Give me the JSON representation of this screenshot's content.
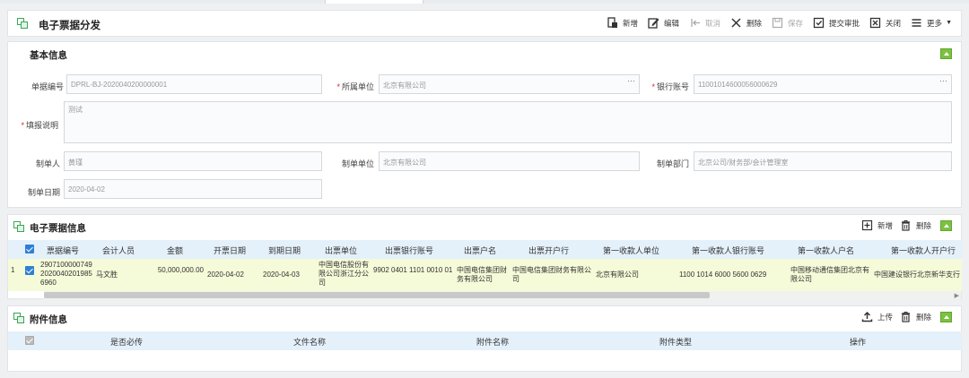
{
  "title": "电子票据分发",
  "toolbar": [
    {
      "label": "新增",
      "icon": "add-doc-icon",
      "disabled": false
    },
    {
      "label": "编辑",
      "icon": "edit-icon",
      "disabled": false
    },
    {
      "label": "取消",
      "icon": "cancel-icon",
      "disabled": true
    },
    {
      "label": "删除",
      "icon": "close-icon",
      "disabled": false
    },
    {
      "label": "保存",
      "icon": "save-icon",
      "disabled": true
    },
    {
      "label": "提交审批",
      "icon": "checkbox-icon",
      "disabled": false
    },
    {
      "label": "关闭",
      "icon": "close-box-icon",
      "disabled": false
    },
    {
      "label": "更多",
      "icon": "menu-icon",
      "disabled": false
    }
  ],
  "basic": {
    "title": "基本信息",
    "bill_no_label": "单据编号",
    "bill_no": "DPRL-BJ-2020040200000001",
    "unit_label": "所属单位",
    "unit": "北京有限公司",
    "account_label": "银行账号",
    "account": "1100101460005600062​9",
    "remark_label": "填报说明",
    "remark": "测试",
    "maker_label": "制单人",
    "maker": "黄瑾",
    "maker_unit_label": "制单单位",
    "maker_unit": "北京有限公司",
    "maker_dept_label": "制单部门",
    "maker_dept": "北京公司/财务部/会计管理室",
    "date_label": "制单日期",
    "date": "2020-04-02",
    "more_glyph": "···"
  },
  "ticket": {
    "title": "电子票据信息",
    "add_label": "新增",
    "delete_label": "删除",
    "headers": [
      "票据编号",
      "会计人员",
      "金额",
      "开票日期",
      "到期日期",
      "出票单位",
      "出票银行账号",
      "出票户名",
      "出票开户行",
      "第一收款人单位",
      "第一收款人银行账号",
      "第一收款人户名",
      "第一收款人开户行"
    ],
    "row": {
      "index": "1",
      "bill_no": "290710000074920200402019856960",
      "accountant": "马文胜",
      "amount": "50,000,000.00",
      "issue_date": "2020-04-02",
      "due_date": "2020-04-03",
      "drawer": "中国电信股份有限公司浙江分公司",
      "drawer_account": "9902 0401 1101 0010 01",
      "drawer_name": "中国电信集团财务有限公司",
      "drawer_bank": "中国电信集团财务有限公司",
      "payee_unit": "北京有限公司",
      "payee_account": "1100 1014 6000 5600 0629",
      "payee_name": "中国移动通信集团北京有限公司",
      "payee_bank": "中国建设银行北京新华支行"
    }
  },
  "attach": {
    "title": "附件信息",
    "upload_label": "上传",
    "delete_label": "删除",
    "headers": [
      "是否必传",
      "文件名称",
      "附件名称",
      "附件类型",
      "操作"
    ]
  },
  "colors": {
    "accent_green": "#7cc142",
    "header_blue": "#e4f1fb",
    "row_highlight": "#f5fbd8",
    "required_red": "#e02020"
  }
}
